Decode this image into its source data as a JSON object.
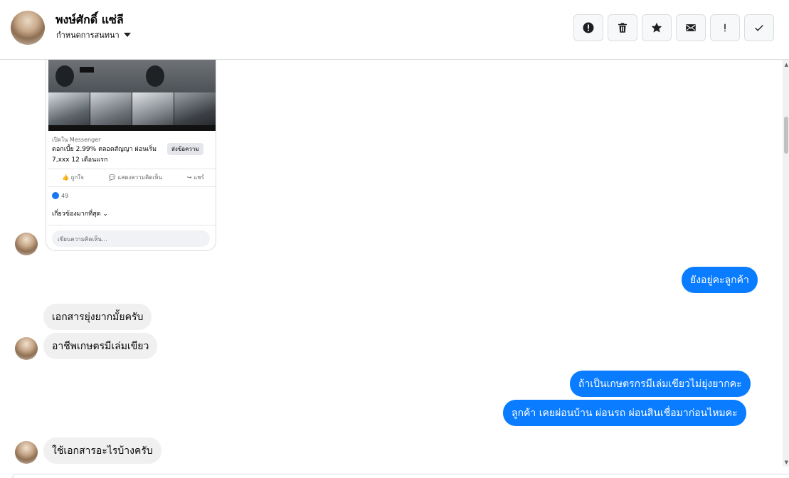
{
  "header": {
    "contact_name": "พงษ์ศักดิ์ แซ่ลี",
    "subtitle": "กำหนดการสนทนา"
  },
  "toolbar": {
    "icons": [
      "alert-circle-icon",
      "trash-icon",
      "star-icon",
      "mail-icon",
      "exclamation-icon",
      "check-icon"
    ]
  },
  "shared_post": {
    "open_in": "เปิดใน Messenger",
    "text": "ดอกเบี้ย 2.99% ตลอดสัญญา ผ่อนเริ่ม 7,xxx 12 เดือนแรก",
    "send_button": "ส่งข้อความ",
    "like_label": "ถูกใจ",
    "comment_label": "แสดงความคิดเห็น",
    "share_label": "แชร์",
    "like_count": "49",
    "sort_label": "เกี่ยวข้องมากที่สุด",
    "comment_placeholder": "เขียนความคิดเห็น..."
  },
  "messages": [
    {
      "side": "out",
      "text": "ยังอยู่คะลูกค้า"
    },
    {
      "side": "in",
      "text": "เอกสารยุ่งยากมั้ยครับ"
    },
    {
      "side": "in",
      "text": "อาชีพเกษตรมีเล่มเขียว"
    },
    {
      "side": "out",
      "text": "ถ้าเป็นเกษตรกรมีเล่มเขียวไม่ยุ่งยากคะ"
    },
    {
      "side": "out",
      "text": "ลูกค้า เคยผ่อนบ้าน ผ่อนรถ ผ่อนสินเชื่อมาก่อนไหมคะ"
    },
    {
      "side": "in",
      "text": "ใช้เอกสารอะไรบ้างครับ"
    }
  ],
  "colors": {
    "outgoing_bubble": "#0a7cff",
    "incoming_bubble": "#f0f0f0",
    "toolbar_button": "#f7f8fa"
  }
}
